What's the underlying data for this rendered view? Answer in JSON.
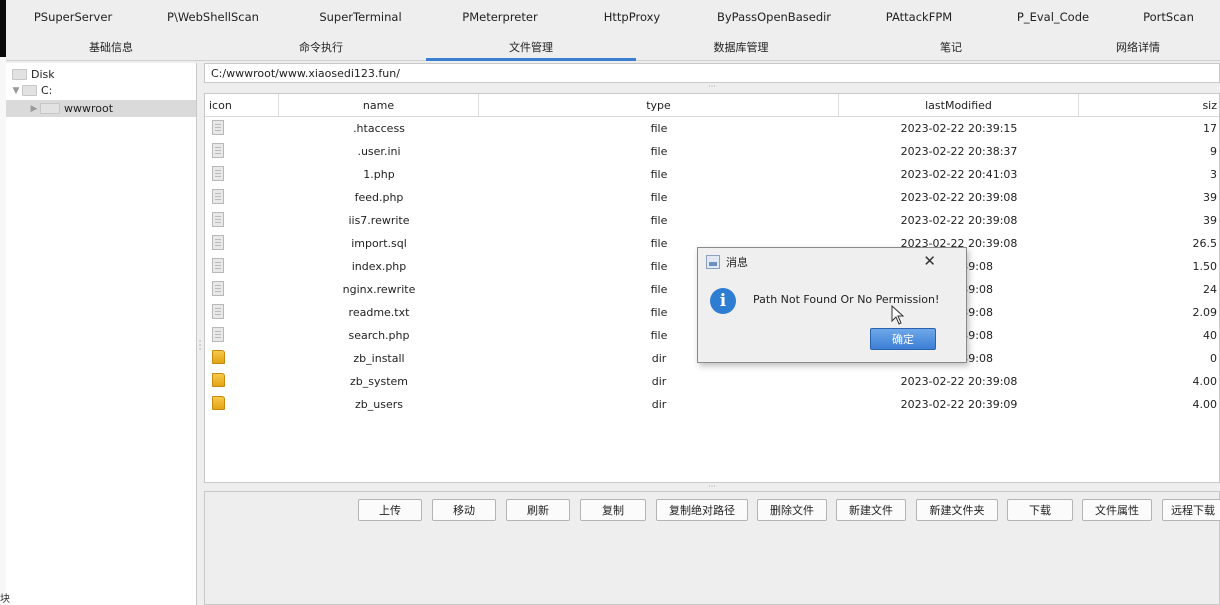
{
  "plugin_tabs": [
    "PSuperServer",
    "P\\WebShellScan",
    "SuperTerminal",
    "PMeterpreter",
    "HttpProxy",
    "ByPassOpenBasedir",
    "PAttackFPM",
    "P_Eval_Code",
    "PortScan"
  ],
  "main_tabs": [
    "基础信息",
    "命令执行",
    "文件管理",
    "数据库管理",
    "笔记",
    "网络详情"
  ],
  "active_main_tab": "文件管理",
  "tree": {
    "root": "Disk",
    "drive": "C:",
    "folder": "wwwroot"
  },
  "path": "C:/wwwroot/www.xiaosedi123.fun/",
  "columns": [
    "icon",
    "name",
    "type",
    "lastModified",
    "siz"
  ],
  "files": [
    {
      "icon": "file-icon",
      "name": ".htaccess",
      "type": "file",
      "lastModified": "2023-02-22 20:39:15",
      "size": "17"
    },
    {
      "icon": "file-icon",
      "name": ".user.ini",
      "type": "file",
      "lastModified": "2023-02-22 20:38:37",
      "size": "9"
    },
    {
      "icon": "file-icon",
      "name": "1.php",
      "type": "file",
      "lastModified": "2023-02-22 20:41:03",
      "size": "3"
    },
    {
      "icon": "file-icon",
      "name": "feed.php",
      "type": "file",
      "lastModified": "2023-02-22 20:39:08",
      "size": "39"
    },
    {
      "icon": "file-icon",
      "name": "iis7.rewrite",
      "type": "file",
      "lastModified": "2023-02-22 20:39:08",
      "size": "39"
    },
    {
      "icon": "file-icon",
      "name": "import.sql",
      "type": "file",
      "lastModified": "2023-02-22 20:39:08",
      "size": "26.5"
    },
    {
      "icon": "file-icon",
      "name": "index.php",
      "type": "file",
      "lastModified": ":39:08",
      "size": "1.50"
    },
    {
      "icon": "file-icon",
      "name": "nginx.rewrite",
      "type": "file",
      "lastModified": ":39:08",
      "size": "24"
    },
    {
      "icon": "file-icon",
      "name": "readme.txt",
      "type": "file",
      "lastModified": ":39:08",
      "size": "2.09"
    },
    {
      "icon": "file-icon",
      "name": "search.php",
      "type": "file",
      "lastModified": ":39:08",
      "size": "40"
    },
    {
      "icon": "folder-icon",
      "name": "zb_install",
      "type": "dir",
      "lastModified": ":39:08",
      "size": "0"
    },
    {
      "icon": "folder-icon",
      "name": "zb_system",
      "type": "dir",
      "lastModified": "2023-02-22 20:39:08",
      "size": "4.00"
    },
    {
      "icon": "folder-icon",
      "name": "zb_users",
      "type": "dir",
      "lastModified": "2023-02-22 20:39:09",
      "size": "4.00"
    }
  ],
  "buttons": [
    "上传",
    "移动",
    "刷新",
    "复制",
    "复制绝对路径",
    "删除文件",
    "新建文件",
    "新建文件夹",
    "下载",
    "文件属性",
    "远程下载"
  ],
  "dialog": {
    "title": "消息",
    "message": "Path Not Found Or No Permission!",
    "ok_label": "确定",
    "close_glyph": "✕",
    "info_glyph": "i"
  },
  "corner_text": "块",
  "colors": {
    "accent": "#3a7fd0",
    "dialog_info": "#2d7dd2",
    "folder_yellow": "#f6c94a"
  }
}
